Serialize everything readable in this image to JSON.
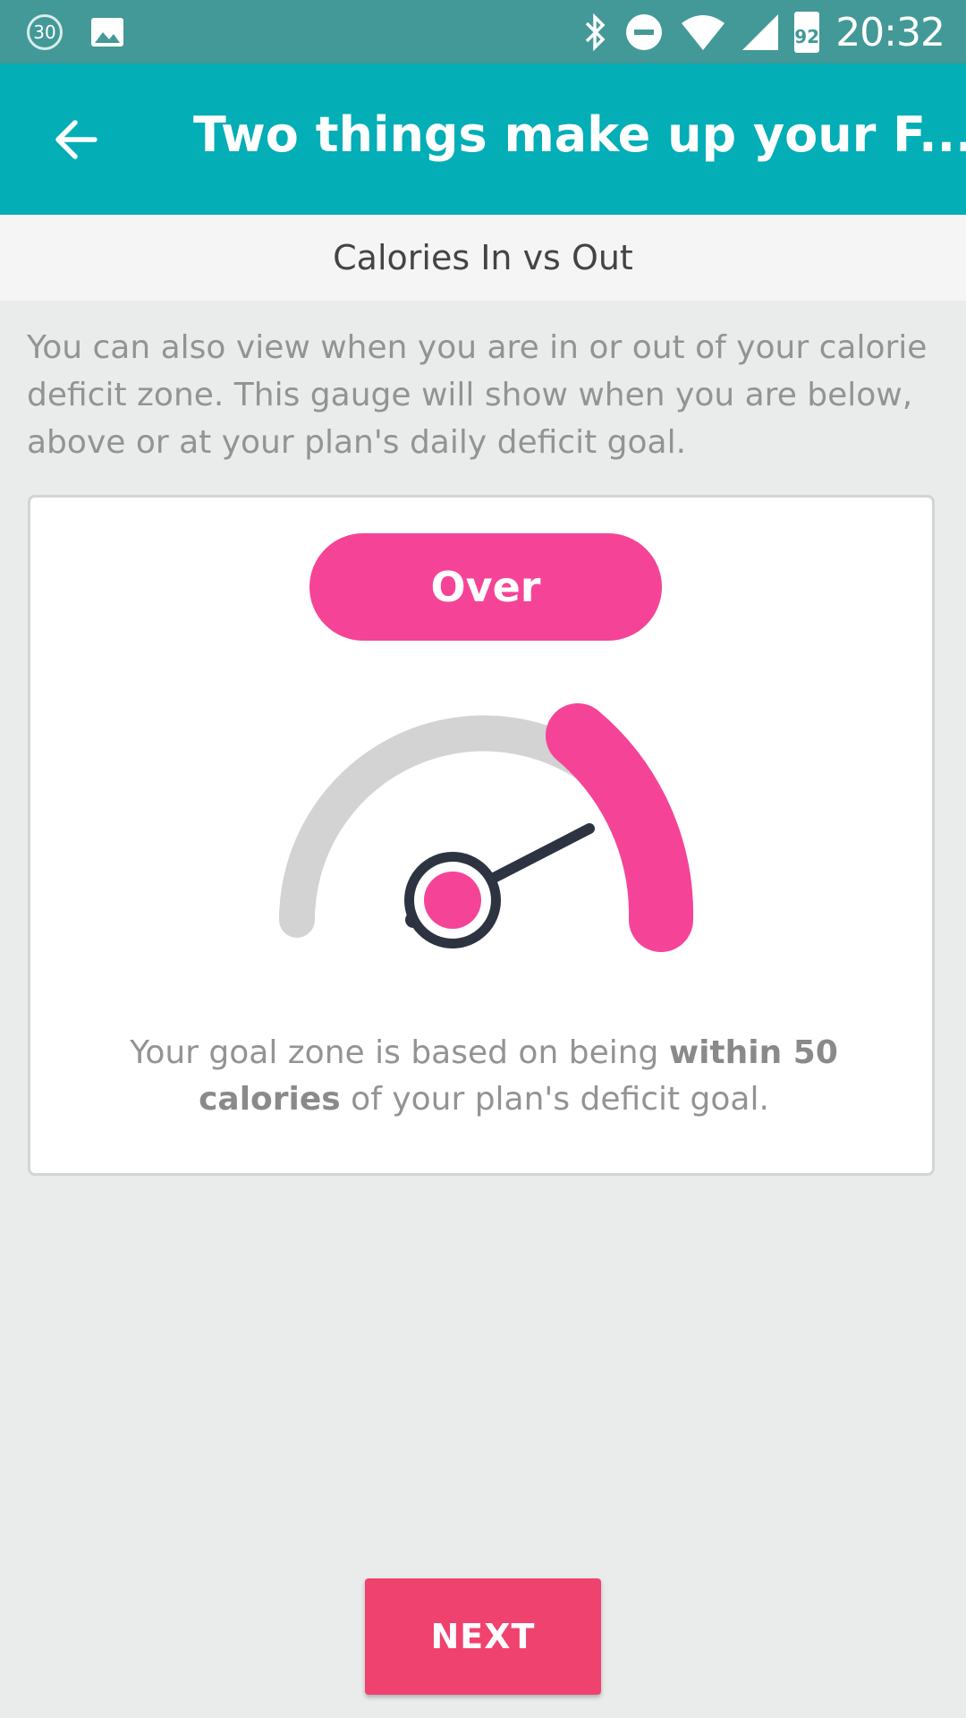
{
  "status_bar": {
    "time": "20:32",
    "notification_badge": "30",
    "battery_level": "92",
    "icons": [
      "calendar-badge-icon",
      "image-icon",
      "bluetooth-icon",
      "do-not-disturb-icon",
      "wifi-icon",
      "cell-signal-icon",
      "battery-icon"
    ]
  },
  "app_bar": {
    "title": "Two things make up your F...",
    "back_icon": "back-arrow-icon"
  },
  "sub_header": {
    "label": "Calories In vs Out"
  },
  "description": "You can also view when you are in or out of your calorie deficit zone. This gauge will show when you are below, above or at your plan's daily deficit goal.",
  "card": {
    "status_label": "Over",
    "gauge": {
      "state": "over",
      "colors": {
        "track": "#d3d3d3",
        "over": "#f54497",
        "needle": "#2d3340"
      }
    },
    "goal_text": {
      "prefix": "Your goal zone is based on being ",
      "bold": "within 50 calories",
      "suffix": " of your plan's deficit goal."
    }
  },
  "next_button": {
    "label": "NEXT"
  },
  "colors": {
    "status_bar": "#439997",
    "app_bar": "#03aeb6",
    "accent_pink": "#f54497",
    "next_button": "#f0426f"
  }
}
